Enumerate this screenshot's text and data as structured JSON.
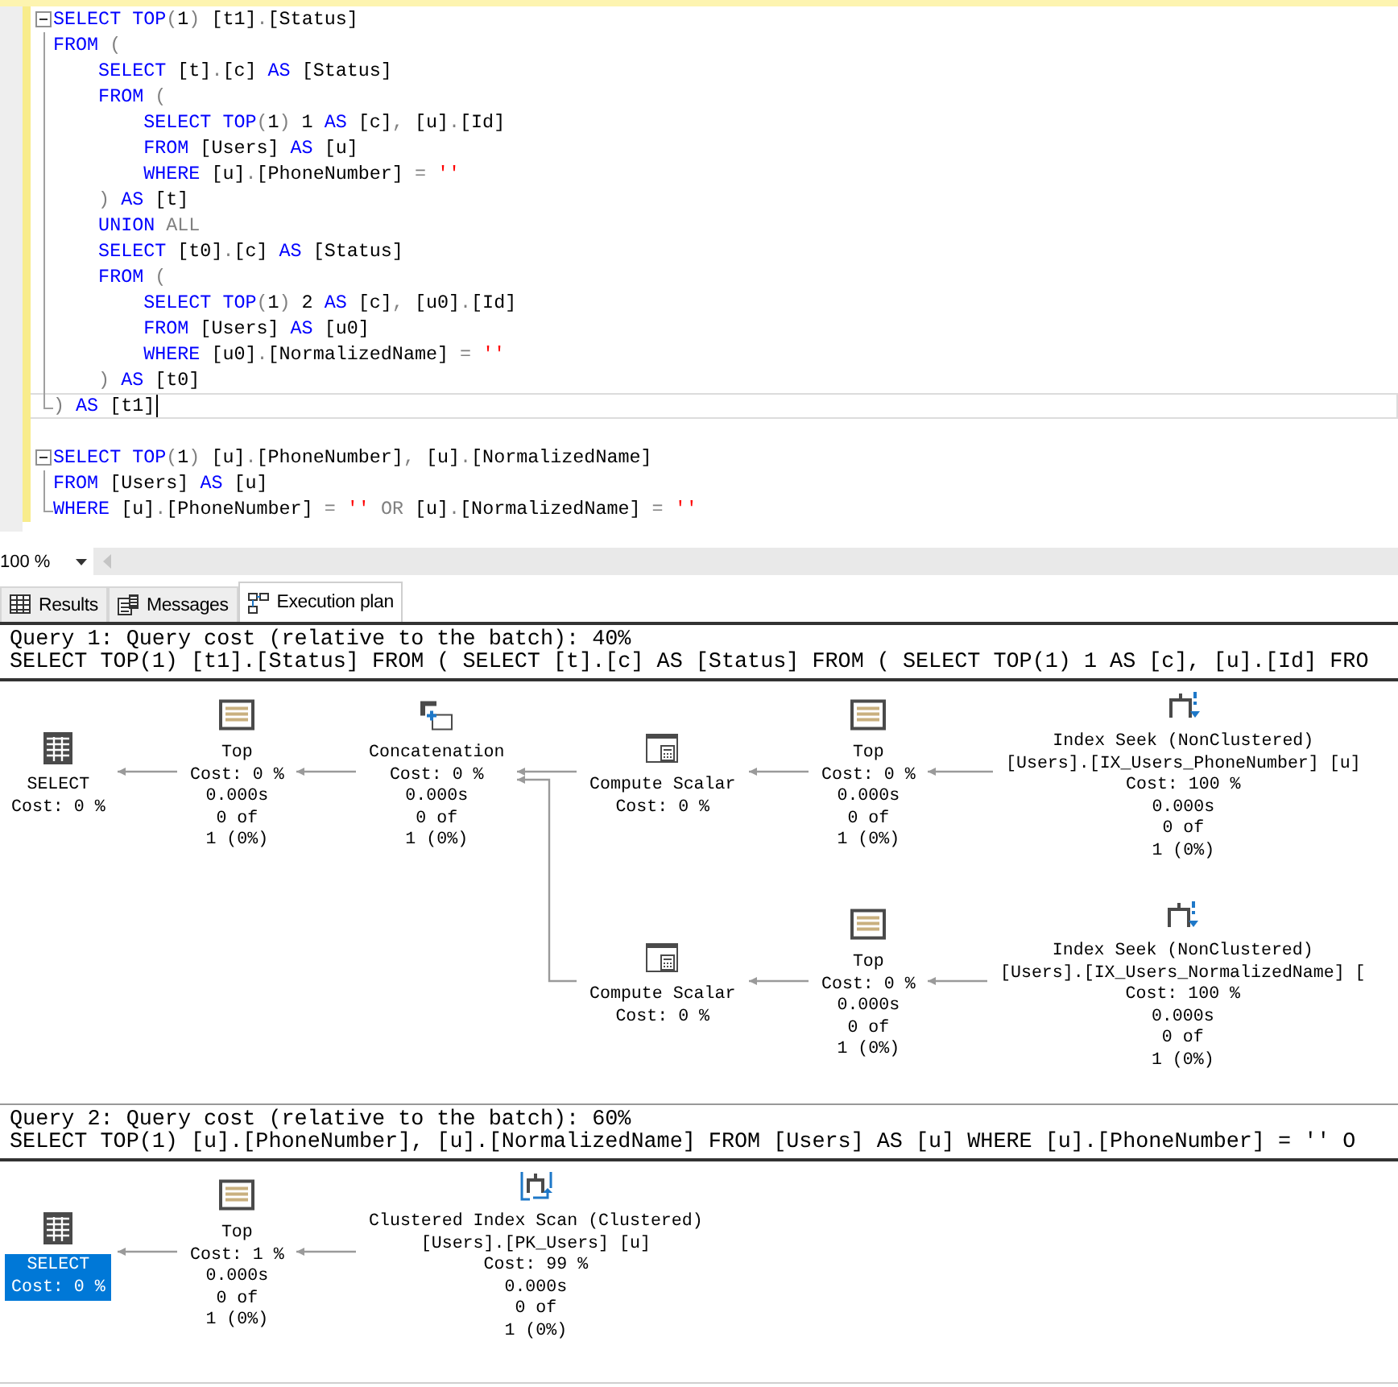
{
  "editor": {
    "blocks": [
      {
        "expanded": true,
        "lines": [
          {
            "current": false,
            "tokens": [
              {
                "kind": "kw",
                "text": "SELECT TOP"
              },
              {
                "kind": "g",
                "text": "("
              },
              {
                "kind": "p",
                "text": "1"
              },
              {
                "kind": "g",
                "text": ")"
              },
              {
                "kind": "p",
                "text": " [t1]"
              },
              {
                "kind": "g",
                "text": "."
              },
              {
                "kind": "p",
                "text": "[Status]"
              }
            ]
          },
          {
            "current": false,
            "tokens": [
              {
                "kind": "kw",
                "text": "FROM"
              },
              {
                "kind": "g",
                "text": " ("
              }
            ]
          },
          {
            "current": false,
            "tokens": [
              {
                "kind": "kw",
                "text": "    SELECT"
              },
              {
                "kind": "p",
                "text": " [t]"
              },
              {
                "kind": "g",
                "text": "."
              },
              {
                "kind": "p",
                "text": "[c] "
              },
              {
                "kind": "kw",
                "text": "AS"
              },
              {
                "kind": "p",
                "text": " [Status]"
              }
            ]
          },
          {
            "current": false,
            "tokens": [
              {
                "kind": "kw",
                "text": "    FROM"
              },
              {
                "kind": "g",
                "text": " ("
              }
            ]
          },
          {
            "current": false,
            "tokens": [
              {
                "kind": "kw",
                "text": "        SELECT TOP"
              },
              {
                "kind": "g",
                "text": "("
              },
              {
                "kind": "p",
                "text": "1"
              },
              {
                "kind": "g",
                "text": ")"
              },
              {
                "kind": "p",
                "text": " 1 "
              },
              {
                "kind": "kw",
                "text": "AS"
              },
              {
                "kind": "p",
                "text": " [c]"
              },
              {
                "kind": "g",
                "text": ","
              },
              {
                "kind": "p",
                "text": " [u]"
              },
              {
                "kind": "g",
                "text": "."
              },
              {
                "kind": "p",
                "text": "[Id]"
              }
            ]
          },
          {
            "current": false,
            "tokens": [
              {
                "kind": "kw",
                "text": "        FROM"
              },
              {
                "kind": "p",
                "text": " [Users] "
              },
              {
                "kind": "kw",
                "text": "AS"
              },
              {
                "kind": "p",
                "text": " [u]"
              }
            ]
          },
          {
            "current": false,
            "tokens": [
              {
                "kind": "kw",
                "text": "        WHERE"
              },
              {
                "kind": "p",
                "text": " [u]"
              },
              {
                "kind": "g",
                "text": "."
              },
              {
                "kind": "p",
                "text": "[PhoneNumber] "
              },
              {
                "kind": "g",
                "text": "= "
              },
              {
                "kind": "s",
                "text": "''"
              }
            ]
          },
          {
            "current": false,
            "tokens": [
              {
                "kind": "g",
                "text": "    )"
              },
              {
                "kind": "kw",
                "text": " AS"
              },
              {
                "kind": "p",
                "text": " [t]"
              }
            ]
          },
          {
            "current": false,
            "tokens": [
              {
                "kind": "kw",
                "text": "    UNION"
              },
              {
                "kind": "g",
                "text": " ALL"
              }
            ]
          },
          {
            "current": false,
            "tokens": [
              {
                "kind": "kw",
                "text": "    SELECT"
              },
              {
                "kind": "p",
                "text": " [t0]"
              },
              {
                "kind": "g",
                "text": "."
              },
              {
                "kind": "p",
                "text": "[c] "
              },
              {
                "kind": "kw",
                "text": "AS"
              },
              {
                "kind": "p",
                "text": " [Status]"
              }
            ]
          },
          {
            "current": false,
            "tokens": [
              {
                "kind": "kw",
                "text": "    FROM"
              },
              {
                "kind": "g",
                "text": " ("
              }
            ]
          },
          {
            "current": false,
            "tokens": [
              {
                "kind": "kw",
                "text": "        SELECT TOP"
              },
              {
                "kind": "g",
                "text": "("
              },
              {
                "kind": "p",
                "text": "1"
              },
              {
                "kind": "g",
                "text": ")"
              },
              {
                "kind": "p",
                "text": " 2 "
              },
              {
                "kind": "kw",
                "text": "AS"
              },
              {
                "kind": "p",
                "text": " [c]"
              },
              {
                "kind": "g",
                "text": ","
              },
              {
                "kind": "p",
                "text": " [u0]"
              },
              {
                "kind": "g",
                "text": "."
              },
              {
                "kind": "p",
                "text": "[Id]"
              }
            ]
          },
          {
            "current": false,
            "tokens": [
              {
                "kind": "kw",
                "text": "        FROM"
              },
              {
                "kind": "p",
                "text": " [Users] "
              },
              {
                "kind": "kw",
                "text": "AS"
              },
              {
                "kind": "p",
                "text": " [u0]"
              }
            ]
          },
          {
            "current": false,
            "tokens": [
              {
                "kind": "kw",
                "text": "        WHERE"
              },
              {
                "kind": "p",
                "text": " [u0]"
              },
              {
                "kind": "g",
                "text": "."
              },
              {
                "kind": "p",
                "text": "[NormalizedName] "
              },
              {
                "kind": "g",
                "text": "= "
              },
              {
                "kind": "s",
                "text": "''"
              }
            ]
          },
          {
            "current": false,
            "tokens": [
              {
                "kind": "g",
                "text": "    )"
              },
              {
                "kind": "kw",
                "text": " AS"
              },
              {
                "kind": "p",
                "text": " [t0]"
              }
            ]
          },
          {
            "current": true,
            "tokens": [
              {
                "kind": "g",
                "text": ")"
              },
              {
                "kind": "kw",
                "text": " AS"
              },
              {
                "kind": "p",
                "text": " [t1]"
              }
            ]
          }
        ]
      },
      {
        "expanded": true,
        "lines": [
          {
            "current": false,
            "tokens": [
              {
                "kind": "kw",
                "text": "SELECT TOP"
              },
              {
                "kind": "g",
                "text": "("
              },
              {
                "kind": "p",
                "text": "1"
              },
              {
                "kind": "g",
                "text": ")"
              },
              {
                "kind": "p",
                "text": " [u]"
              },
              {
                "kind": "g",
                "text": "."
              },
              {
                "kind": "p",
                "text": "[PhoneNumber]"
              },
              {
                "kind": "g",
                "text": ","
              },
              {
                "kind": "p",
                "text": " [u]"
              },
              {
                "kind": "g",
                "text": "."
              },
              {
                "kind": "p",
                "text": "[NormalizedName]"
              }
            ]
          },
          {
            "current": false,
            "tokens": [
              {
                "kind": "kw",
                "text": "FROM"
              },
              {
                "kind": "p",
                "text": " [Users] "
              },
              {
                "kind": "kw",
                "text": "AS"
              },
              {
                "kind": "p",
                "text": " [u]"
              }
            ]
          },
          {
            "current": false,
            "tokens": [
              {
                "kind": "kw",
                "text": "WHERE"
              },
              {
                "kind": "p",
                "text": " [u]"
              },
              {
                "kind": "g",
                "text": "."
              },
              {
                "kind": "p",
                "text": "[PhoneNumber] "
              },
              {
                "kind": "g",
                "text": "= "
              },
              {
                "kind": "s",
                "text": "'' "
              },
              {
                "kind": "g",
                "text": "OR"
              },
              {
                "kind": "p",
                "text": " [u]"
              },
              {
                "kind": "g",
                "text": "."
              },
              {
                "kind": "p",
                "text": "[NormalizedName] "
              },
              {
                "kind": "g",
                "text": "= "
              },
              {
                "kind": "s",
                "text": "''"
              }
            ]
          }
        ]
      }
    ]
  },
  "zoom": {
    "value": "100 %"
  },
  "tabs": [
    {
      "label": "Results",
      "selected": false
    },
    {
      "label": "Messages",
      "selected": false
    },
    {
      "label": "Execution plan",
      "selected": true
    }
  ],
  "plans": [
    {
      "header": "Query 1: Query cost (relative to the batch): 40%",
      "sql": "SELECT TOP(1) [t1].[Status] FROM ( SELECT [t].[c] AS [Status] FROM ( SELECT TOP(1) 1 AS [c], [u].[Id] FRO",
      "root": {
        "kind": "select",
        "title": "SELECT",
        "lines": [
          "Cost: 0 %"
        ],
        "selected": false,
        "children": [
          {
            "kind": "top",
            "title": "Top",
            "lines": [
              "Cost: 0 %",
              "0.000s",
              "0 of",
              "1 (0%)"
            ],
            "selected": false,
            "children": [
              {
                "kind": "concatenation",
                "title": "Concatenation",
                "lines": [
                  "Cost: 0 %",
                  "0.000s",
                  "0 of",
                  "1 (0%)"
                ],
                "selected": false,
                "children": [
                  {
                    "kind": "compute_scalar",
                    "title": "Compute Scalar",
                    "lines": [
                      "Cost: 0 %"
                    ],
                    "selected": false,
                    "children": [
                      {
                        "kind": "top",
                        "title": "Top",
                        "lines": [
                          "Cost: 0 %",
                          "0.000s",
                          "0 of",
                          "1 (0%)"
                        ],
                        "selected": false,
                        "children": [
                          {
                            "kind": "index_seek",
                            "title": "Index Seek (NonClustered)",
                            "lines": [
                              "[Users].[IX_Users_PhoneNumber] [u]",
                              "Cost: 100 %",
                              "0.000s",
                              "0 of",
                              "1 (0%)"
                            ],
                            "selected": false
                          }
                        ]
                      }
                    ]
                  },
                  {
                    "kind": "compute_scalar",
                    "title": "Compute Scalar",
                    "lines": [
                      "Cost: 0 %"
                    ],
                    "selected": false,
                    "children": [
                      {
                        "kind": "top",
                        "title": "Top",
                        "lines": [
                          "Cost: 0 %",
                          "0.000s",
                          "0 of",
                          "1 (0%)"
                        ],
                        "selected": false,
                        "children": [
                          {
                            "kind": "index_seek",
                            "title": "Index Seek (NonClustered)",
                            "lines": [
                              "[Users].[IX_Users_NormalizedName] [",
                              "Cost: 100 %",
                              "0.000s",
                              "0 of",
                              "1 (0%)"
                            ],
                            "selected": false
                          }
                        ]
                      }
                    ]
                  }
                ]
              }
            ]
          }
        ]
      }
    },
    {
      "header": "Query 2: Query cost (relative to the batch): 60%",
      "sql": "SELECT TOP(1) [u].[PhoneNumber], [u].[NormalizedName] FROM [Users] AS [u] WHERE [u].[PhoneNumber] = '' O",
      "root": {
        "kind": "select",
        "title": "SELECT",
        "lines": [
          "Cost: 0 %"
        ],
        "selected": true,
        "children": [
          {
            "kind": "top",
            "title": "Top",
            "lines": [
              "Cost: 1 %",
              "0.000s",
              "0 of",
              "1 (0%)"
            ],
            "selected": false,
            "children": [
              {
                "kind": "clustered_index_scan",
                "title": "Clustered Index Scan (Clustered)",
                "lines": [
                  "[Users].[PK_Users] [u]",
                  "Cost: 99 %",
                  "0.000s",
                  "0 of",
                  "1 (0%)"
                ],
                "selected": false
              }
            ]
          }
        ]
      }
    }
  ]
}
